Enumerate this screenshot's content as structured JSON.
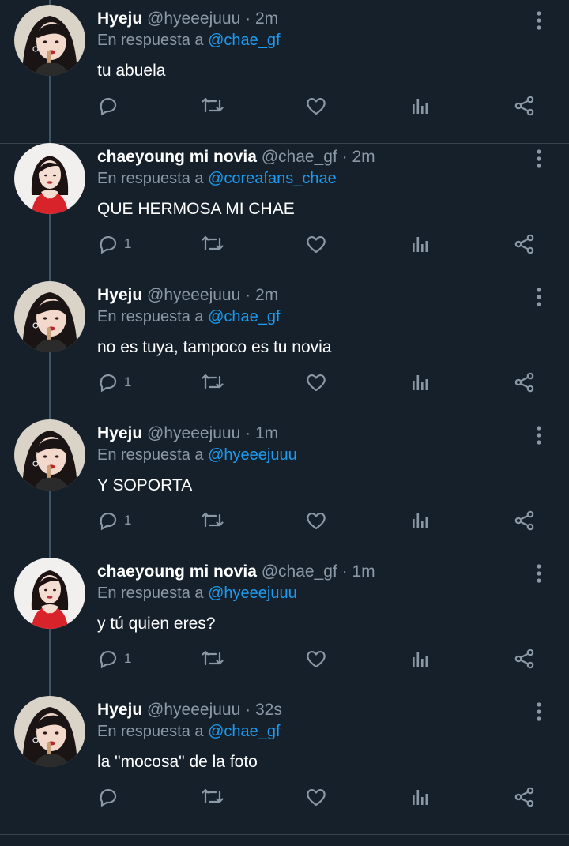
{
  "thread": {
    "reply_prefix": "En respuesta a",
    "tweets": [
      {
        "avatar": "hyeju",
        "name": "Hyeju",
        "handle": "@hyeeejuuu",
        "dot": "·",
        "time": "2m",
        "mention": "@chae_gf",
        "text": "tu abuela",
        "reply_count": ""
      },
      {
        "avatar": "chae",
        "name": "chaeyoung mi novia",
        "handle": "@chae_gf",
        "dot": "·",
        "time": "2m",
        "mention": "@coreafans_chae",
        "text": "QUE HERMOSA MI CHAE",
        "reply_count": "1"
      },
      {
        "avatar": "hyeju",
        "name": "Hyeju",
        "handle": "@hyeeejuuu",
        "dot": "·",
        "time": "2m",
        "mention": "@chae_gf",
        "text": "no es tuya, tampoco es tu novia",
        "reply_count": "1"
      },
      {
        "avatar": "hyeju",
        "name": "Hyeju",
        "handle": "@hyeeejuuu",
        "dot": "·",
        "time": "1m",
        "mention": "@hyeeejuuu",
        "text": "Y SOPORTA",
        "reply_count": "1"
      },
      {
        "avatar": "chae",
        "name": "chaeyoung mi novia",
        "handle": "@chae_gf",
        "dot": "·",
        "time": "1m",
        "mention": "@hyeeejuuu",
        "text": "y tú quien eres?",
        "reply_count": "1"
      },
      {
        "avatar": "hyeju",
        "name": "Hyeju",
        "handle": "@hyeeejuuu",
        "dot": "·",
        "time": "32s",
        "mention": "@chae_gf",
        "text": "la \"mocosa\" de la foto",
        "reply_count": ""
      }
    ]
  },
  "icons": {
    "reply": "speech-bubble-icon",
    "retweet": "retweet-icon",
    "like": "heart-icon",
    "views": "bar-chart-icon",
    "share": "share-icon",
    "more": "vertical-dots-icon"
  },
  "colors": {
    "background": "#15202b",
    "accent": "#1d9bf0",
    "muted": "#8b98a5",
    "thread_line": "#3d5466"
  }
}
